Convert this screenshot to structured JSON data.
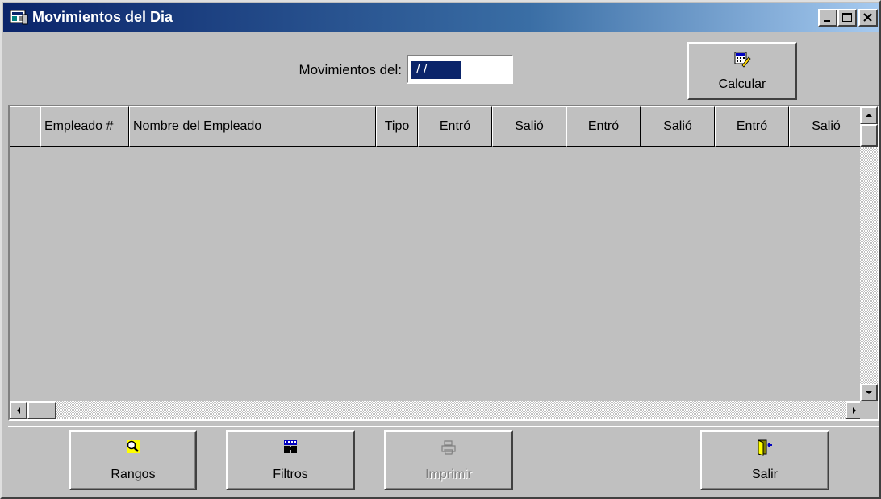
{
  "window": {
    "title": "Movimientos del Dia",
    "controls": [
      "minimize-icon",
      "maximize-icon",
      "close-icon"
    ]
  },
  "filter": {
    "label": "Movimientos del:",
    "date_value": " / /"
  },
  "buttons": {
    "calcular": "Calcular",
    "rangos": "Rangos",
    "filtros": "Filtros",
    "imprimir": "Imprimir",
    "salir": "Salir"
  },
  "grid": {
    "columns": [
      "",
      "Empleado #",
      "Nombre del Empleado",
      "Tipo",
      "Entró",
      "Salió",
      "Entró",
      "Salió",
      "Entró",
      "Salió"
    ],
    "rows": []
  },
  "colors": {
    "face": "#c0c0c0",
    "title_start": "#0a246a",
    "title_end": "#a6caf0",
    "selection": "#0a246a"
  }
}
